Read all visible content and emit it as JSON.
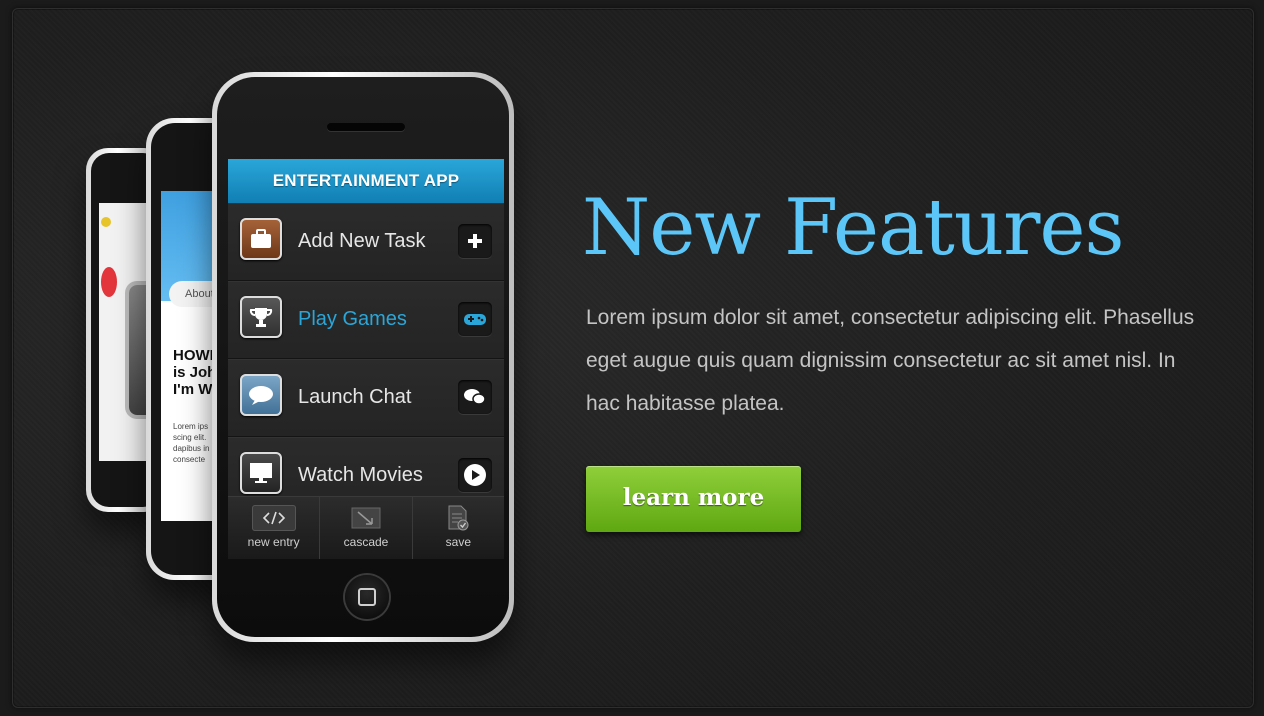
{
  "hero": {
    "title": "New Features",
    "description": "Lorem ipsum dolor sit amet, consectetur adipiscing elit. Phasellus eget augue quis quam dignissim consectetur ac sit amet nisl. In hac habitasse platea.",
    "cta_label": "learn more",
    "accent_color": "#5bc6f7",
    "button_color": "#6db524"
  },
  "phone_main": {
    "app_title": "ENTERTAINMENT APP",
    "header_color": "#1a92c7",
    "menu": [
      {
        "label": "Add New Task",
        "icon": "briefcase-icon",
        "action_icon": "plus-icon",
        "active": false
      },
      {
        "label": "Play Games",
        "icon": "trophy-icon",
        "action_icon": "gamepad-icon",
        "active": true
      },
      {
        "label": "Launch Chat",
        "icon": "speech-bubble-icon",
        "action_icon": "chat-icon",
        "active": false
      },
      {
        "label": "Watch Movies",
        "icon": "monitor-icon",
        "action_icon": "play-icon",
        "active": false
      }
    ],
    "tabs": [
      {
        "label": "new entry",
        "icon": "code-icon"
      },
      {
        "label": "cascade",
        "icon": "cascade-icon"
      },
      {
        "label": "save",
        "icon": "save-document-icon"
      }
    ]
  },
  "phone_middle": {
    "button_label": "About",
    "headline": "HOWE\nis Joh\nI'm W",
    "body": "Lorem ips\nscing elit.\ndapibus in\nconsecte"
  }
}
